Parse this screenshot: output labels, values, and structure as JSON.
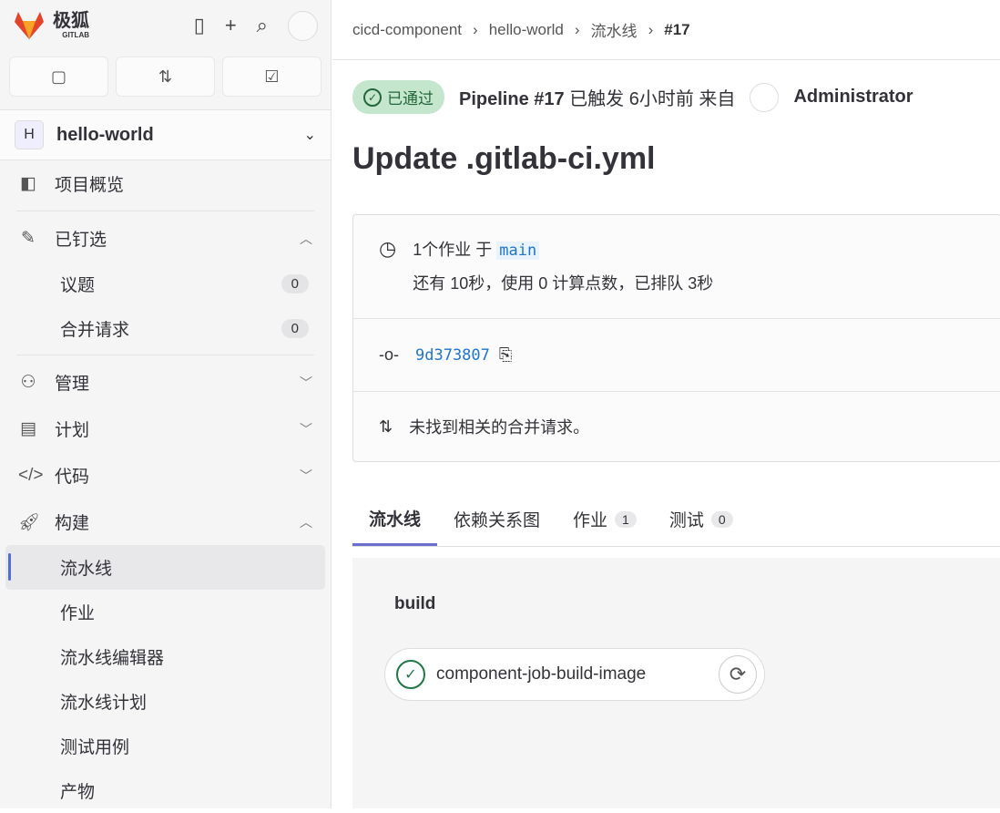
{
  "brand": {
    "name": "极狐",
    "sub": "GITLAB"
  },
  "project": {
    "initial": "H",
    "name": "hello-world"
  },
  "nav": {
    "overview": "项目概览",
    "pinned": "已钉选",
    "issues": "议题",
    "issues_count": "0",
    "mrs": "合并请求",
    "mrs_count": "0",
    "manage": "管理",
    "plan": "计划",
    "code": "代码",
    "build": "构建",
    "pipelines": "流水线",
    "jobs": "作业",
    "editor": "流水线编辑器",
    "schedules": "流水线计划",
    "tests": "测试用例",
    "artifacts": "产物"
  },
  "breadcrumb": [
    "cicd-component",
    "hello-world",
    "流水线",
    "#17"
  ],
  "header": {
    "status": "已通过",
    "pipeline": "Pipeline #17",
    "triggered": "已触发 6小时前 来自",
    "user": "Administrator"
  },
  "title": "Update .gitlab-ci.yml",
  "info": {
    "jobs": "1个作业 于",
    "branch": "main",
    "duration": "还有 10秒，使用 0 计算点数，已排队 3秒",
    "commit": "9d373807",
    "mr": "未找到相关的合并请求。"
  },
  "tabs": [
    {
      "label": "流水线"
    },
    {
      "label": "依赖关系图"
    },
    {
      "label": "作业",
      "count": "1"
    },
    {
      "label": "测试",
      "count": "0"
    }
  ],
  "graph": {
    "stage": "build",
    "job": "component-job-build-image"
  }
}
